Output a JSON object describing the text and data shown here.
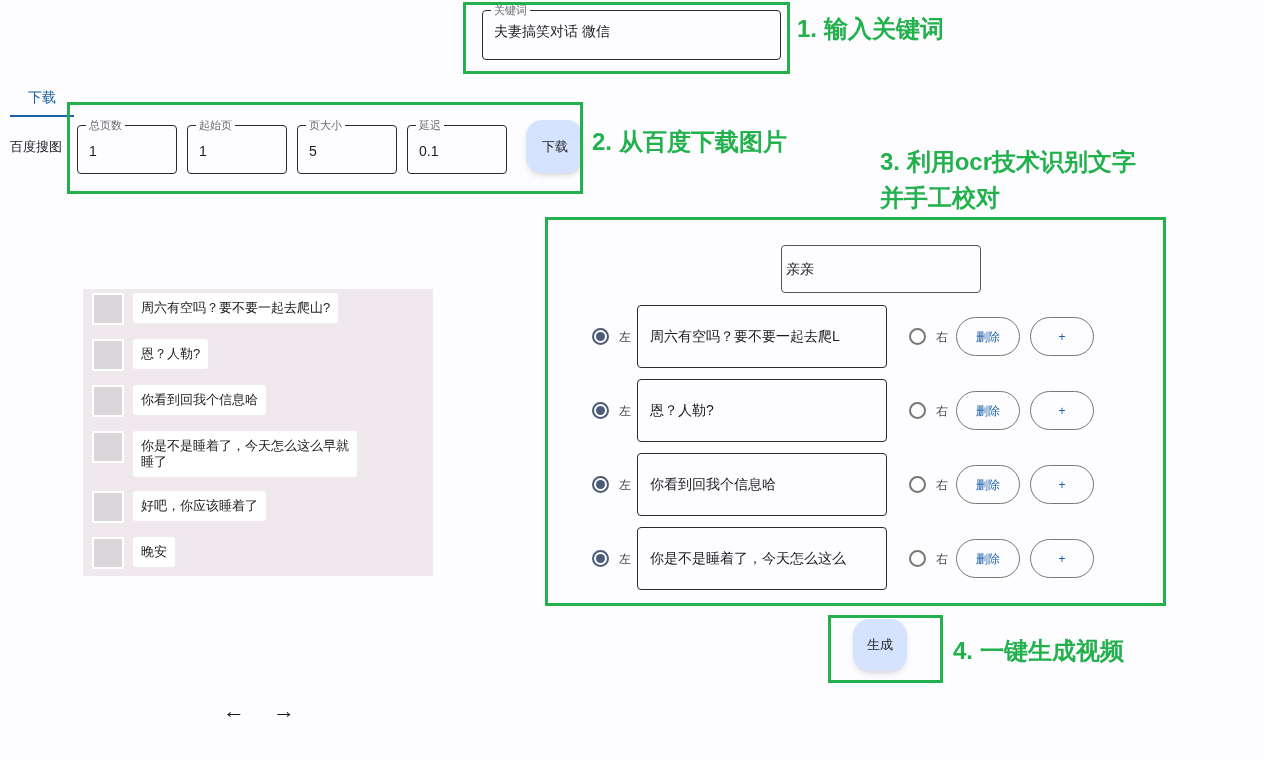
{
  "keyword_field": {
    "label": "关键词",
    "value": "夫妻搞笑对话 微信"
  },
  "tabs": [
    {
      "label": "下载",
      "selected": true
    }
  ],
  "source_label": "百度搜图",
  "download_fields": [
    {
      "label": "总页数",
      "value": "1"
    },
    {
      "label": "起始页",
      "value": "1"
    },
    {
      "label": "页大小",
      "value": "5"
    },
    {
      "label": "延迟",
      "value": "0.1"
    }
  ],
  "download_button": "下载",
  "chat_image": {
    "messages": [
      {
        "text": "周六有空吗？要不要一起去爬山?"
      },
      {
        "text": "恩？人勒?"
      },
      {
        "text": "你看到回我个信息哈"
      },
      {
        "text": "你是不是睡着了，今天怎么这么早就睡了"
      },
      {
        "text": "好吧，你应该睡着了"
      },
      {
        "text": "晚安"
      }
    ]
  },
  "nav": {
    "prev": "←",
    "next": "→"
  },
  "name_field": {
    "value": "亲亲"
  },
  "message_rows": [
    {
      "text": "周六有空吗？要不要一起去爬L",
      "left_label": "左",
      "left_selected": true,
      "right_label": "右",
      "right_selected": false,
      "delete_label": "删除",
      "add_label": "+"
    },
    {
      "text": "恩？人勒?",
      "left_label": "左",
      "left_selected": true,
      "right_label": "右",
      "right_selected": false,
      "delete_label": "删除",
      "add_label": "+"
    },
    {
      "text": "你看到回我个信息哈",
      "left_label": "左",
      "left_selected": true,
      "right_label": "右",
      "right_selected": false,
      "delete_label": "删除",
      "add_label": "+"
    },
    {
      "text": "你是不是睡着了，今天怎么这么",
      "left_label": "左",
      "left_selected": true,
      "right_label": "右",
      "right_selected": false,
      "delete_label": "删除",
      "add_label": "+"
    }
  ],
  "generate_button": "生成",
  "annotations": [
    {
      "text": "1. 输入关键词"
    },
    {
      "text": "2. 从百度下载图片"
    },
    {
      "text": "3. 利用ocr技术识别文字"
    },
    {
      "text": "并手工校对"
    },
    {
      "text": "4. 一键生成视频"
    }
  ]
}
